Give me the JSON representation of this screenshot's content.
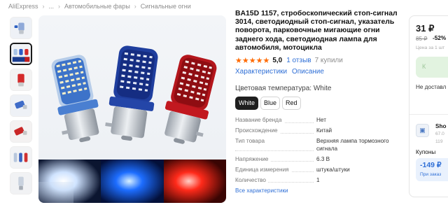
{
  "breadcrumb": [
    "AliExpress",
    "...",
    "Автомобильные фары",
    "Сигнальные огни"
  ],
  "product": {
    "title": "BA15D 1157, стробоскопический стоп-сигнал 3014, светодиодный стоп-сигнал, указатель поворота, парковочные мигающие огни заднего хода, светодиодная лампа для автомобиля, мотоцикла",
    "rating_stars": "★★★★★",
    "rating": "5,0",
    "reviews": "1 отзыв",
    "bought": "7 купили",
    "link_characteristics": "Характеристики",
    "link_description": "Описание",
    "color_label": "Цветовая температура: White",
    "options": [
      {
        "label": "White",
        "selected": true
      },
      {
        "label": "Blue",
        "selected": false
      },
      {
        "label": "Red",
        "selected": false
      }
    ],
    "specs": [
      {
        "key": "Название бренда",
        "value": "Нет"
      },
      {
        "key": "Происхождение",
        "value": "Китай"
      },
      {
        "key": "Тип товара",
        "value": "Верхняя лампа тормозного сигнала"
      },
      {
        "key": "Напряжение",
        "value": "6.3 В"
      },
      {
        "key": "Единица измерения",
        "value": "штука/штуки"
      },
      {
        "key": "Количество",
        "value": "1"
      }
    ],
    "all_specs_link": "Все характеристики"
  },
  "buybox": {
    "price": "31 ₽",
    "old_price": "85 ₽",
    "discount": "-52%",
    "price_note": "Цена за 1 шт",
    "buy_label": "К",
    "delivery_note": "Не доставл",
    "shop_name": "Sho",
    "shop_line1": "67.0",
    "shop_line2": "119",
    "coupons_label": "Купоны",
    "coupon_amount": "-149 ₽",
    "coupon_note": "При заказ"
  },
  "colors": {
    "link": "#2f6fd6",
    "star": "#ff6a00",
    "selected_option": "#1f1f1f",
    "buy_button": "#e2f3e0",
    "coupon_bg": "#e9f1fd"
  },
  "icons": [
    "white-led-bulb",
    "blue-led-bulb",
    "red-led-bulb",
    "shop-icon"
  ]
}
